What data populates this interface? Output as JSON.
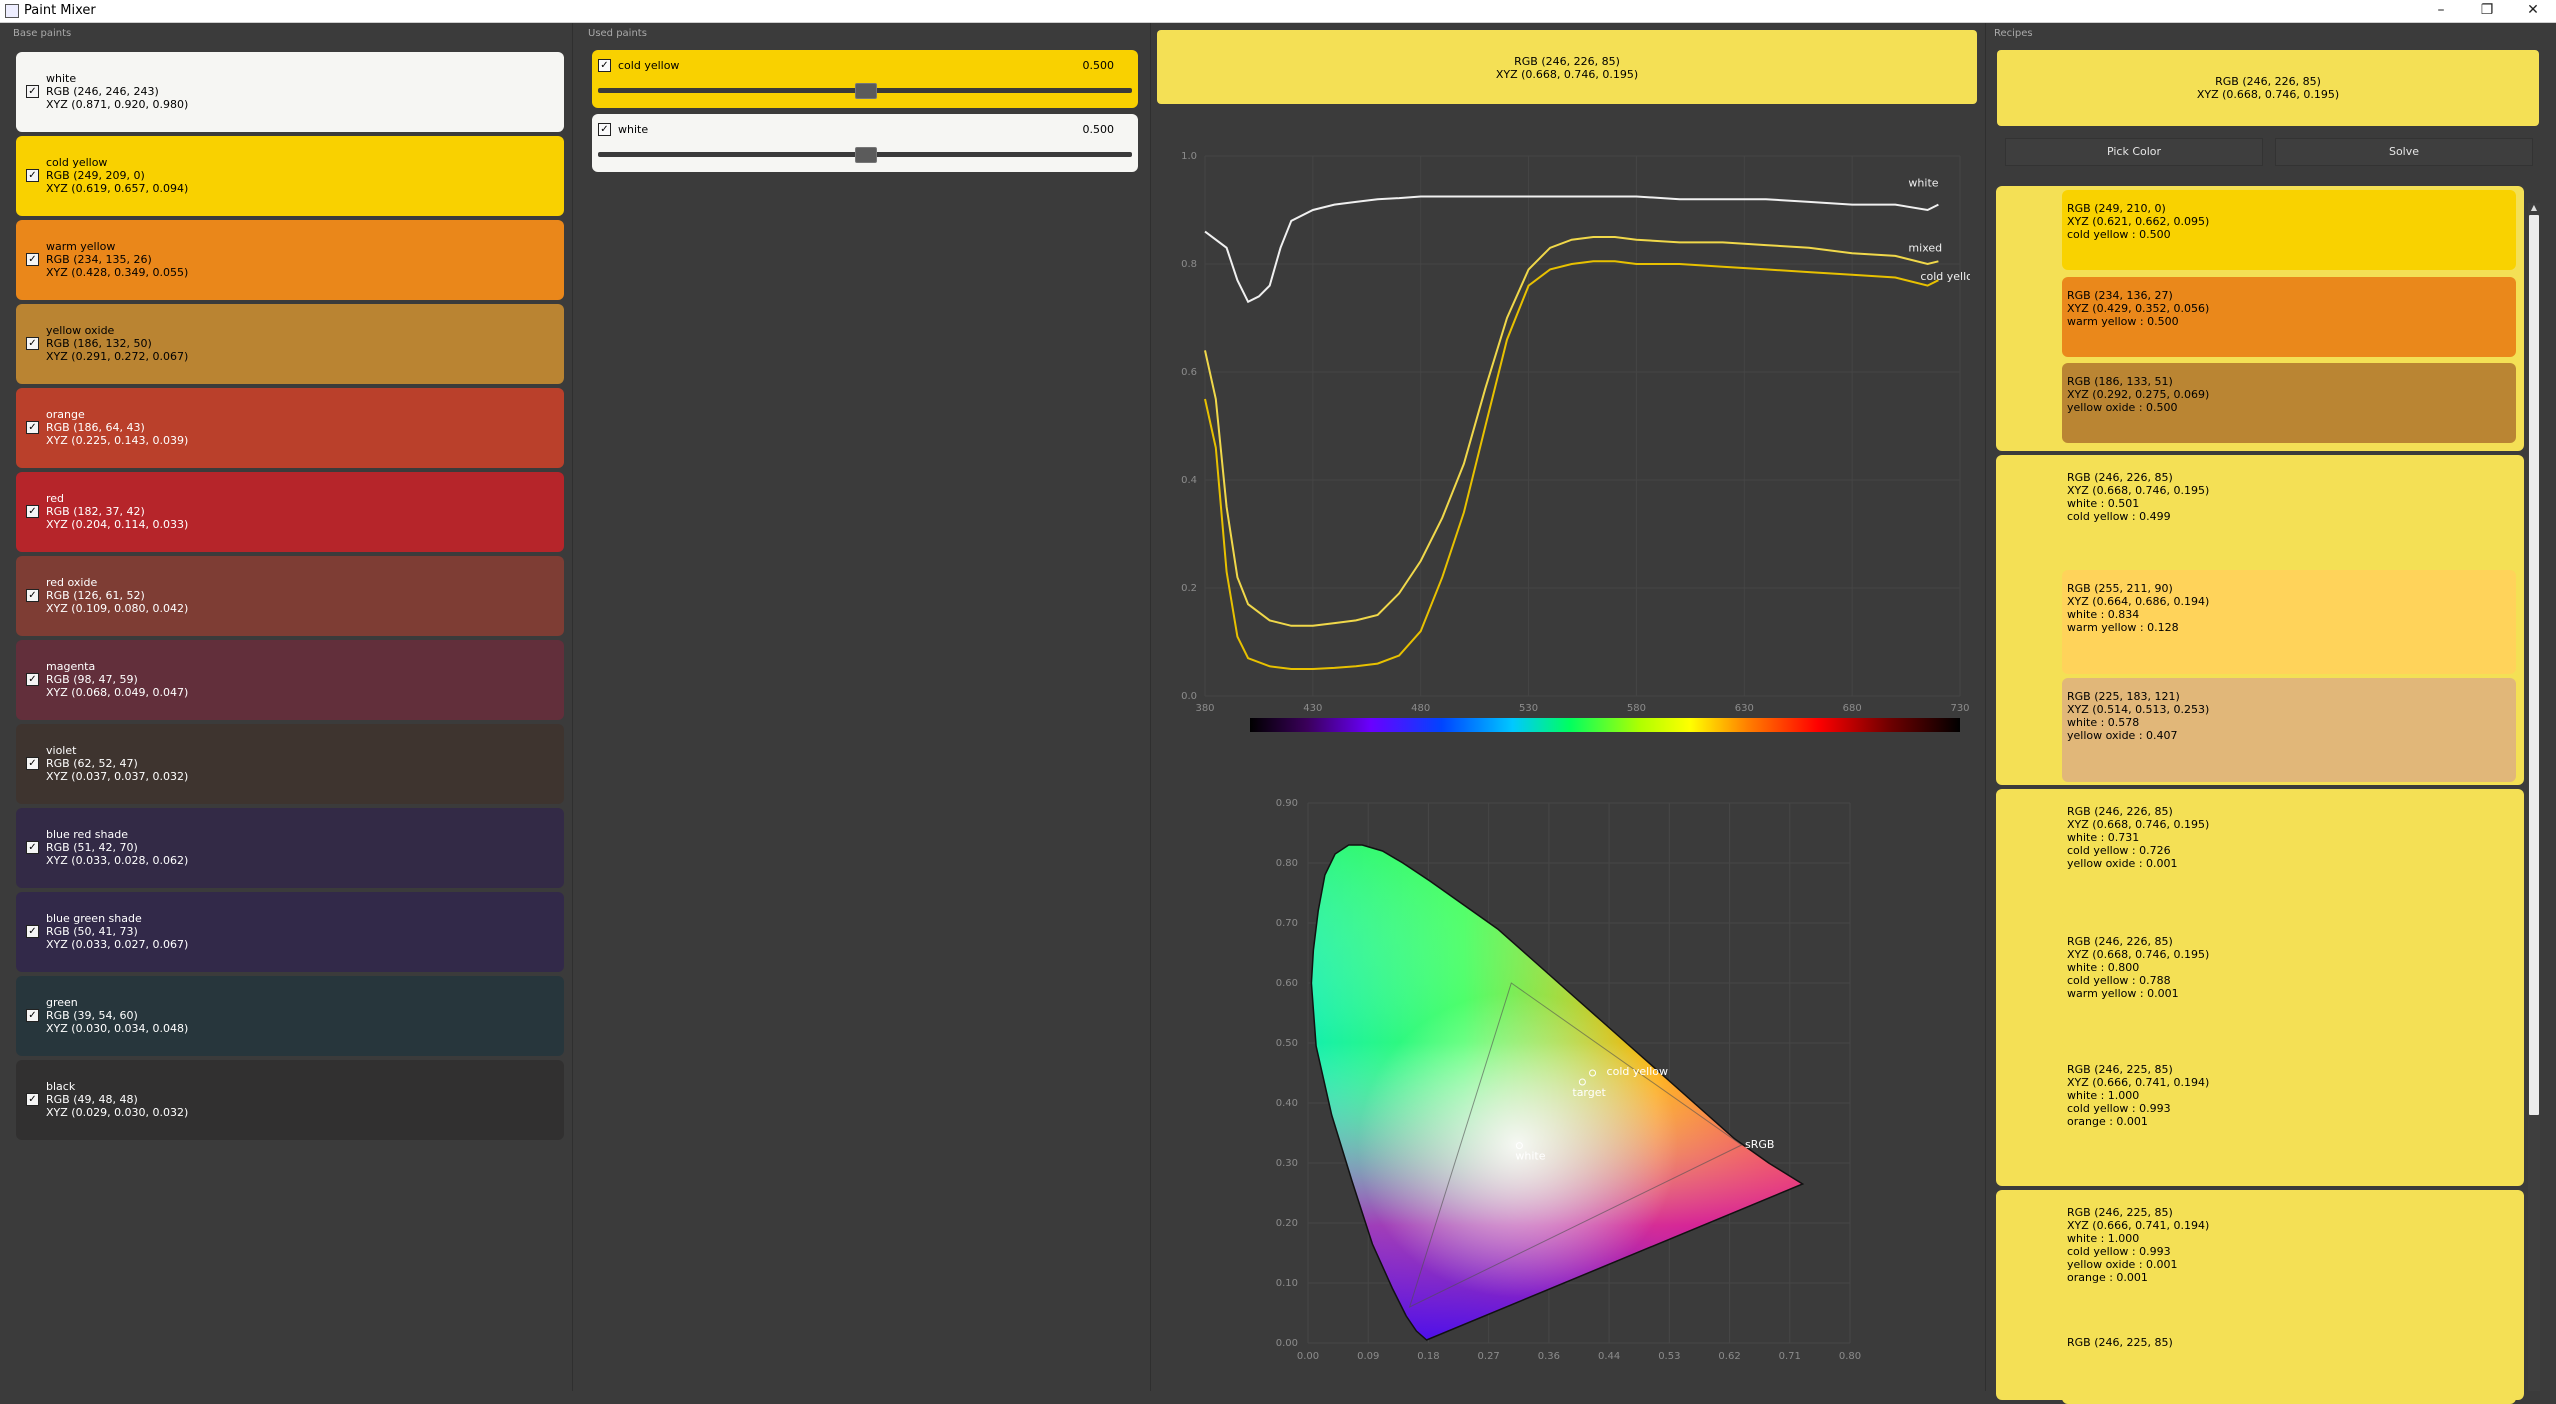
{
  "window": {
    "title": "Paint Mixer",
    "minimize": "–",
    "maximize": "❐",
    "close": "✕"
  },
  "panels": {
    "base": "Base paints",
    "used": "Used paints",
    "recipes": "Recipes"
  },
  "base_paints": [
    {
      "name": "white",
      "rgb": "RGB (246, 246, 243)",
      "xyz": "XYZ (0.871, 0.920, 0.980)",
      "bg": "#f6f6f3",
      "fg": "#000000",
      "checked": true
    },
    {
      "name": "cold yellow",
      "rgb": "RGB (249, 209, 0)",
      "xyz": "XYZ (0.619, 0.657, 0.094)",
      "bg": "#f9d100",
      "fg": "#000000",
      "checked": true
    },
    {
      "name": "warm yellow",
      "rgb": "RGB (234, 135, 26)",
      "xyz": "XYZ (0.428, 0.349, 0.055)",
      "bg": "#ea871a",
      "fg": "#000000",
      "checked": true
    },
    {
      "name": "yellow oxide",
      "rgb": "RGB (186, 132, 50)",
      "xyz": "XYZ (0.291, 0.272, 0.067)",
      "bg": "#ba8432",
      "fg": "#000000",
      "checked": true
    },
    {
      "name": "orange",
      "rgb": "RGB (186, 64, 43)",
      "xyz": "XYZ (0.225, 0.143, 0.039)",
      "bg": "#ba402b",
      "fg": "#ffffff",
      "checked": true
    },
    {
      "name": "red",
      "rgb": "RGB (182, 37, 42)",
      "xyz": "XYZ (0.204, 0.114, 0.033)",
      "bg": "#b6252a",
      "fg": "#ffffff",
      "checked": true
    },
    {
      "name": "red oxide",
      "rgb": "RGB (126, 61, 52)",
      "xyz": "XYZ (0.109, 0.080, 0.042)",
      "bg": "#7e3d34",
      "fg": "#ffffff",
      "checked": true
    },
    {
      "name": "magenta",
      "rgb": "RGB (98, 47, 59)",
      "xyz": "XYZ (0.068, 0.049, 0.047)",
      "bg": "#622f3b",
      "fg": "#ffffff",
      "checked": true
    },
    {
      "name": "violet",
      "rgb": "RGB (62, 52, 47)",
      "xyz": "XYZ (0.037, 0.037, 0.032)",
      "bg": "#3e342f",
      "fg": "#ffffff",
      "checked": true
    },
    {
      "name": "blue red shade",
      "rgb": "RGB (51, 42, 70)",
      "xyz": "XYZ (0.033, 0.028, 0.062)",
      "bg": "#332a46",
      "fg": "#ffffff",
      "checked": true
    },
    {
      "name": "blue green shade",
      "rgb": "RGB (50, 41, 73)",
      "xyz": "XYZ (0.033, 0.027, 0.067)",
      "bg": "#322949",
      "fg": "#ffffff",
      "checked": true
    },
    {
      "name": "green",
      "rgb": "RGB (39, 54, 60)",
      "xyz": "XYZ (0.030, 0.034, 0.048)",
      "bg": "#27363c",
      "fg": "#ffffff",
      "checked": true
    },
    {
      "name": "black",
      "rgb": "RGB (49, 48, 48)",
      "xyz": "XYZ (0.029, 0.030, 0.032)",
      "bg": "#313030",
      "fg": "#ffffff",
      "checked": true
    }
  ],
  "used_paints": [
    {
      "name": "cold yellow",
      "value": "0.500",
      "level": 0.5,
      "bg": "#f9d100",
      "checked": true
    },
    {
      "name": "white",
      "value": "0.500",
      "level": 0.5,
      "bg": "#f6f6f3",
      "checked": true
    }
  ],
  "mixed": {
    "rgb": "RGB (246, 226, 85)",
    "xyz": "XYZ (0.668, 0.746, 0.195)",
    "color": "#f4e055"
  },
  "buttons": {
    "pick": "Pick Color",
    "solve": "Solve"
  },
  "recipes": [
    {
      "items": [
        {
          "lines": [
            "RGB (249, 210, 0)",
            "XYZ (0.621, 0.662, 0.095)",
            "cold yellow : 0.500"
          ],
          "bg": "#f9d200",
          "fg": "#000000"
        },
        {
          "lines": [
            "RGB (234, 136, 27)",
            "XYZ (0.429, 0.352, 0.056)",
            "warm yellow : 0.500"
          ],
          "bg": "#ea881b",
          "fg": "#000000"
        },
        {
          "lines": [
            "RGB (186, 133, 51)",
            "XYZ (0.292, 0.275, 0.069)",
            "yellow oxide : 0.500"
          ],
          "bg": "#ba8533",
          "fg": "#000000"
        }
      ]
    },
    {
      "items": [
        {
          "lines": [
            "RGB (246, 226, 85)",
            "XYZ (0.668, 0.746, 0.195)",
            "white : 0.501",
            "cold yellow : 0.499"
          ],
          "bg": "#f4e055",
          "fg": "#000000"
        },
        {
          "lines": [
            "RGB (255, 211, 90)",
            "XYZ (0.664, 0.686, 0.194)",
            "white : 0.834",
            "warm yellow : 0.128"
          ],
          "bg": "#ffd35a",
          "fg": "#000000"
        },
        {
          "lines": [
            "RGB (225, 183, 121)",
            "XYZ (0.514, 0.513, 0.253)",
            "white : 0.578",
            "yellow oxide : 0.407"
          ],
          "bg": "#e1b779",
          "fg": "#000000"
        }
      ]
    },
    {
      "items": [
        {
          "lines": [
            "RGB (246, 226, 85)",
            "XYZ (0.668, 0.746, 0.195)",
            "white : 0.731",
            "cold yellow : 0.726",
            "yellow oxide : 0.001"
          ],
          "bg": "#f4e055",
          "fg": "#000000"
        },
        {
          "lines": [
            "RGB (246, 226, 85)",
            "XYZ (0.668, 0.746, 0.195)",
            "white : 0.800",
            "cold yellow : 0.788",
            "warm yellow : 0.001"
          ],
          "bg": "#f4e055",
          "fg": "#000000"
        },
        {
          "lines": [
            "RGB (246, 225, 85)",
            "XYZ (0.666, 0.741, 0.194)",
            "white : 1.000",
            "cold yellow : 0.993",
            "orange : 0.001"
          ],
          "bg": "#f4e055",
          "fg": "#000000"
        }
      ]
    },
    {
      "items": [
        {
          "lines": [
            "RGB (246, 225, 85)",
            "XYZ (0.666, 0.741, 0.194)",
            "white : 1.000",
            "cold yellow : 0.993",
            "yellow oxide : 0.001",
            "orange : 0.001"
          ],
          "bg": "#f4e055",
          "fg": "#000000"
        },
        {
          "lines": [
            "RGB (246, 225, 85)"
          ],
          "bg": "#f4e055",
          "fg": "#000000"
        }
      ]
    }
  ],
  "chart_data": [
    {
      "type": "line",
      "title": "",
      "xlim": [
        380,
        730
      ],
      "ylim": [
        0,
        1.0
      ],
      "xticks": [
        "380",
        "430",
        "480",
        "530",
        "580",
        "630",
        "680",
        "730"
      ],
      "yticks": [
        "0.0",
        "0.2",
        "0.4",
        "0.6",
        "0.8",
        "1.0"
      ],
      "series": [
        {
          "name": "white",
          "color": "#f0f0f0",
          "x": [
            380,
            390,
            395,
            400,
            405,
            410,
            415,
            420,
            430,
            440,
            450,
            460,
            470,
            480,
            500,
            520,
            540,
            560,
            580,
            600,
            620,
            640,
            660,
            680,
            700,
            715,
            720
          ],
          "y": [
            0.86,
            0.83,
            0.77,
            0.73,
            0.74,
            0.76,
            0.83,
            0.88,
            0.9,
            0.91,
            0.915,
            0.92,
            0.922,
            0.925,
            0.925,
            0.925,
            0.925,
            0.925,
            0.925,
            0.92,
            0.92,
            0.92,
            0.915,
            0.91,
            0.91,
            0.9,
            0.91
          ]
        },
        {
          "name": "mixed",
          "color": "#f0d84a",
          "x": [
            380,
            385,
            390,
            395,
            400,
            410,
            420,
            430,
            440,
            450,
            460,
            470,
            480,
            490,
            500,
            510,
            520,
            530,
            540,
            550,
            560,
            570,
            580,
            600,
            620,
            640,
            660,
            680,
            700,
            715,
            720
          ],
          "y": [
            0.64,
            0.55,
            0.35,
            0.22,
            0.17,
            0.14,
            0.13,
            0.13,
            0.135,
            0.14,
            0.15,
            0.19,
            0.25,
            0.33,
            0.43,
            0.57,
            0.7,
            0.79,
            0.83,
            0.845,
            0.85,
            0.85,
            0.845,
            0.84,
            0.84,
            0.835,
            0.83,
            0.82,
            0.815,
            0.8,
            0.805
          ]
        },
        {
          "name": "cold yellow",
          "color": "#e8c100",
          "x": [
            380,
            385,
            390,
            395,
            400,
            410,
            420,
            430,
            440,
            450,
            460,
            470,
            480,
            490,
            500,
            510,
            520,
            530,
            540,
            550,
            560,
            570,
            580,
            600,
            620,
            640,
            660,
            680,
            700,
            715,
            720
          ],
          "y": [
            0.55,
            0.46,
            0.23,
            0.11,
            0.07,
            0.055,
            0.05,
            0.05,
            0.052,
            0.055,
            0.06,
            0.075,
            0.12,
            0.22,
            0.34,
            0.5,
            0.66,
            0.76,
            0.79,
            0.8,
            0.805,
            0.805,
            0.8,
            0.8,
            0.795,
            0.79,
            0.785,
            0.78,
            0.775,
            0.76,
            0.77
          ]
        }
      ]
    },
    {
      "type": "scatter",
      "title": "",
      "xlim": [
        0,
        0.8
      ],
      "ylim": [
        0,
        0.9
      ],
      "xticks": [
        "0.00",
        "0.09",
        "0.18",
        "0.27",
        "0.36",
        "0.44",
        "0.53",
        "0.62",
        "0.71",
        "0.80"
      ],
      "yticks": [
        "0.00",
        "0.10",
        "0.20",
        "0.30",
        "0.40",
        "0.50",
        "0.60",
        "0.70",
        "0.80",
        "0.90"
      ],
      "locus": [
        [
          0.175,
          0.005
        ],
        [
          0.17,
          0.01
        ],
        [
          0.16,
          0.02
        ],
        [
          0.145,
          0.045
        ],
        [
          0.125,
          0.09
        ],
        [
          0.095,
          0.165
        ],
        [
          0.065,
          0.27
        ],
        [
          0.035,
          0.38
        ],
        [
          0.012,
          0.495
        ],
        [
          0.005,
          0.6
        ],
        [
          0.008,
          0.655
        ],
        [
          0.015,
          0.72
        ],
        [
          0.025,
          0.78
        ],
        [
          0.04,
          0.815
        ],
        [
          0.06,
          0.83
        ],
        [
          0.08,
          0.83
        ],
        [
          0.11,
          0.82
        ],
        [
          0.14,
          0.8
        ],
        [
          0.18,
          0.77
        ],
        [
          0.23,
          0.73
        ],
        [
          0.28,
          0.69
        ],
        [
          0.33,
          0.64
        ],
        [
          0.38,
          0.59
        ],
        [
          0.43,
          0.54
        ],
        [
          0.48,
          0.49
        ],
        [
          0.53,
          0.44
        ],
        [
          0.58,
          0.39
        ],
        [
          0.63,
          0.34
        ],
        [
          0.68,
          0.3
        ],
        [
          0.73,
          0.265
        ],
        [
          0.175,
          0.005
        ]
      ],
      "srgb": [
        [
          0.64,
          0.33
        ],
        [
          0.3,
          0.6
        ],
        [
          0.15,
          0.06
        ]
      ],
      "points": [
        {
          "label": "cold yellow",
          "x": 0.42,
          "y": 0.45
        },
        {
          "label": "target",
          "x": 0.405,
          "y": 0.435
        },
        {
          "label": "white",
          "x": 0.312,
          "y": 0.329
        },
        {
          "label": "sRGB",
          "x": 0.645,
          "y": 0.325
        }
      ]
    }
  ]
}
